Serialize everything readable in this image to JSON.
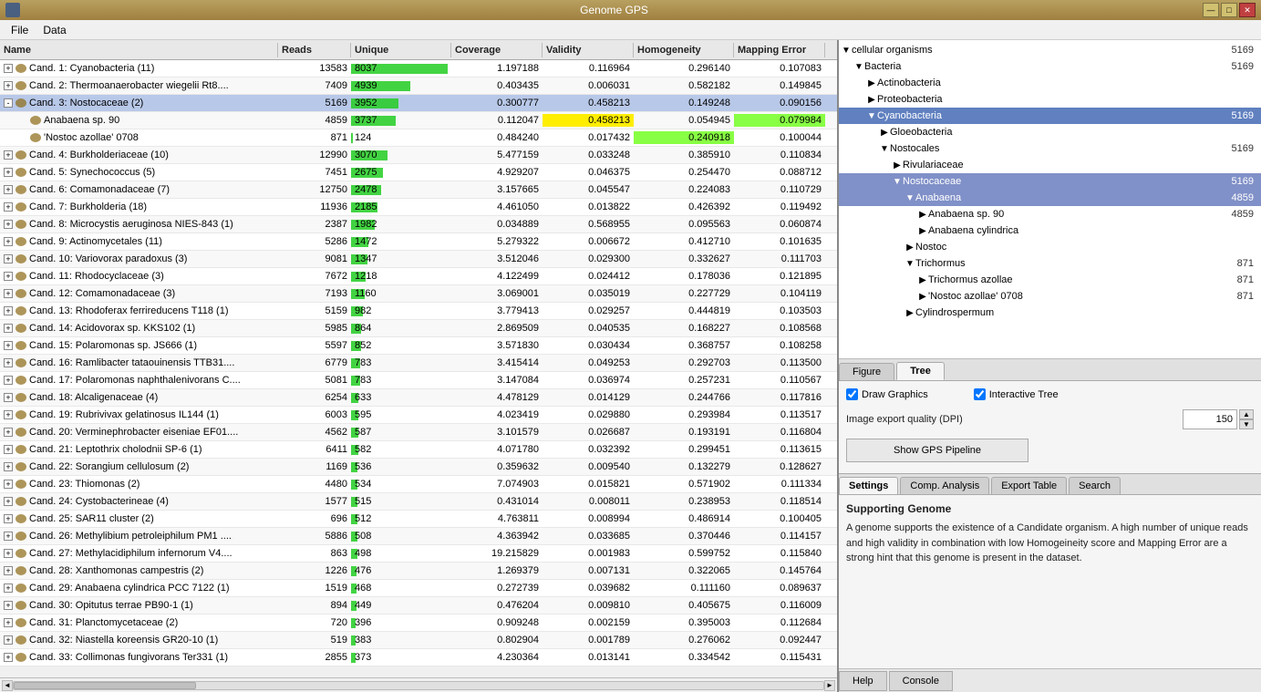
{
  "titlebar": {
    "title": "Genome GPS",
    "app_icon": "genome-icon",
    "controls": {
      "minimize": "—",
      "maximize": "□",
      "close": "✕"
    }
  },
  "menubar": {
    "items": [
      "File",
      "Data"
    ]
  },
  "table": {
    "columns": [
      "Name",
      "Reads",
      "Unique",
      "Coverage",
      "Validity",
      "Homogeneity",
      "Mapping Error"
    ],
    "rows": [
      {
        "name": "Cand. 1: Cyanobacteria (11)",
        "reads": "13583",
        "unique": "8037",
        "coverage": "1.197188",
        "validity": "0.116964",
        "homogeneity": "0.296140",
        "mapping": "0.107083",
        "indent": 0,
        "uniquePct": 100,
        "expanded": false
      },
      {
        "name": "Cand. 2: Thermoanaerobacter wiegelii Rt8....",
        "reads": "7409",
        "unique": "4939",
        "coverage": "0.403435",
        "validity": "0.006031",
        "homogeneity": "0.582182",
        "mapping": "0.149845",
        "indent": 0,
        "uniquePct": 60,
        "expanded": false
      },
      {
        "name": "Cand. 3: Nostocaceae (2)",
        "reads": "5169",
        "unique": "3952",
        "coverage": "0.300777",
        "validity": "0.458213",
        "homogeneity": "0.149248",
        "mapping": "0.090156",
        "indent": 0,
        "uniquePct": 48,
        "expanded": true,
        "selected": true
      },
      {
        "name": "Anabaena sp. 90",
        "reads": "4859",
        "unique": "3737",
        "coverage": "0.112047",
        "validity": "0.458213",
        "homogeneity": "0.054945",
        "mapping": "0.079984",
        "indent": 1,
        "uniquePct": 45,
        "expanded": false,
        "validityHL": true,
        "mappingHL": true
      },
      {
        "name": "'Nostoc azollae' 0708",
        "reads": "871",
        "unique": "124",
        "coverage": "0.484240",
        "validity": "0.017432",
        "homogeneity": "0.240918",
        "mapping": "0.100044",
        "indent": 1,
        "uniquePct": 1,
        "expanded": false,
        "homogeneityHL": true
      },
      {
        "name": "Cand. 4: Burkholderiaceae (10)",
        "reads": "12990",
        "unique": "3070",
        "coverage": "5.477159",
        "validity": "0.033248",
        "homogeneity": "0.385910",
        "mapping": "0.110834",
        "indent": 0,
        "uniquePct": 36,
        "expanded": false
      },
      {
        "name": "Cand. 5: Synechococcus (5)",
        "reads": "7451",
        "unique": "2675",
        "coverage": "4.929207",
        "validity": "0.046375",
        "homogeneity": "0.254470",
        "mapping": "0.088712",
        "indent": 0,
        "uniquePct": 32,
        "expanded": false
      },
      {
        "name": "Cand. 6: Comamonadaceae (7)",
        "reads": "12750",
        "unique": "2478",
        "coverage": "3.157665",
        "validity": "0.045547",
        "homogeneity": "0.224083",
        "mapping": "0.110729",
        "indent": 0,
        "uniquePct": 29,
        "expanded": false
      },
      {
        "name": "Cand. 7: Burkholderia (18)",
        "reads": "11936",
        "unique": "2185",
        "coverage": "4.461050",
        "validity": "0.013822",
        "homogeneity": "0.426392",
        "mapping": "0.119492",
        "indent": 0,
        "uniquePct": 26,
        "expanded": false
      },
      {
        "name": "Cand. 8: Microcystis aeruginosa NIES-843 (1)",
        "reads": "2387",
        "unique": "1982",
        "coverage": "0.034889",
        "validity": "0.568955",
        "homogeneity": "0.095563",
        "mapping": "0.060874",
        "indent": 0,
        "uniquePct": 24,
        "expanded": false
      },
      {
        "name": "Cand. 9: Actinomycetales (11)",
        "reads": "5286",
        "unique": "1472",
        "coverage": "5.279322",
        "validity": "0.006672",
        "homogeneity": "0.412710",
        "mapping": "0.101635",
        "indent": 0,
        "uniquePct": 18,
        "expanded": false
      },
      {
        "name": "Cand. 10: Variovorax paradoxus (3)",
        "reads": "9081",
        "unique": "1347",
        "coverage": "3.512046",
        "validity": "0.029300",
        "homogeneity": "0.332627",
        "mapping": "0.111703",
        "indent": 0,
        "uniquePct": 16,
        "expanded": false
      },
      {
        "name": "Cand. 11: Rhodocyclaceae (3)",
        "reads": "7672",
        "unique": "1218",
        "coverage": "4.122499",
        "validity": "0.024412",
        "homogeneity": "0.178036",
        "mapping": "0.121895",
        "indent": 0,
        "uniquePct": 15,
        "expanded": false
      },
      {
        "name": "Cand. 12: Comamonadaceae (3)",
        "reads": "7193",
        "unique": "1160",
        "coverage": "3.069001",
        "validity": "0.035019",
        "homogeneity": "0.227729",
        "mapping": "0.104119",
        "indent": 0,
        "uniquePct": 14,
        "expanded": false
      },
      {
        "name": "Cand. 13: Rhodoferax ferrireducens T118 (1)",
        "reads": "5159",
        "unique": "982",
        "coverage": "3.779413",
        "validity": "0.029257",
        "homogeneity": "0.444819",
        "mapping": "0.103503",
        "indent": 0,
        "uniquePct": 12,
        "expanded": false
      },
      {
        "name": "Cand. 14: Acidovorax sp. KKS102 (1)",
        "reads": "5985",
        "unique": "864",
        "coverage": "2.869509",
        "validity": "0.040535",
        "homogeneity": "0.168227",
        "mapping": "0.108568",
        "indent": 0,
        "uniquePct": 10,
        "expanded": false
      },
      {
        "name": "Cand. 15: Polaromonas sp. JS666 (1)",
        "reads": "5597",
        "unique": "852",
        "coverage": "3.571830",
        "validity": "0.030434",
        "homogeneity": "0.368757",
        "mapping": "0.108258",
        "indent": 0,
        "uniquePct": 10,
        "expanded": false
      },
      {
        "name": "Cand. 16: Ramlibacter tataouinensis TTB31....",
        "reads": "6779",
        "unique": "783",
        "coverage": "3.415414",
        "validity": "0.049253",
        "homogeneity": "0.292703",
        "mapping": "0.113500",
        "indent": 0,
        "uniquePct": 9,
        "expanded": false
      },
      {
        "name": "Cand. 17: Polaromonas naphthalenivorans C....",
        "reads": "5081",
        "unique": "783",
        "coverage": "3.147084",
        "validity": "0.036974",
        "homogeneity": "0.257231",
        "mapping": "0.110567",
        "indent": 0,
        "uniquePct": 9,
        "expanded": false
      },
      {
        "name": "Cand. 18: Alcaligenaceae (4)",
        "reads": "6254",
        "unique": "633",
        "coverage": "4.478129",
        "validity": "0.014129",
        "homogeneity": "0.244766",
        "mapping": "0.117816",
        "indent": 0,
        "uniquePct": 8,
        "expanded": false
      },
      {
        "name": "Cand. 19: Rubrivivax gelatinosus IL144 (1)",
        "reads": "6003",
        "unique": "595",
        "coverage": "4.023419",
        "validity": "0.029880",
        "homogeneity": "0.293984",
        "mapping": "0.113517",
        "indent": 0,
        "uniquePct": 7,
        "expanded": false
      },
      {
        "name": "Cand. 20: Verminephrobacter eiseniae EF01....",
        "reads": "4562",
        "unique": "587",
        "coverage": "3.101579",
        "validity": "0.026687",
        "homogeneity": "0.193191",
        "mapping": "0.116804",
        "indent": 0,
        "uniquePct": 7,
        "expanded": false
      },
      {
        "name": "Cand. 21: Leptothrix cholodnii SP-6 (1)",
        "reads": "6411",
        "unique": "582",
        "coverage": "4.071780",
        "validity": "0.032392",
        "homogeneity": "0.299451",
        "mapping": "0.113615",
        "indent": 0,
        "uniquePct": 7,
        "expanded": false
      },
      {
        "name": "Cand. 22: Sorangium cellulosum (2)",
        "reads": "1169",
        "unique": "536",
        "coverage": "0.359632",
        "validity": "0.009540",
        "homogeneity": "0.132279",
        "mapping": "0.128627",
        "indent": 0,
        "uniquePct": 7,
        "expanded": false
      },
      {
        "name": "Cand. 23: Thiomonas (2)",
        "reads": "4480",
        "unique": "534",
        "coverage": "7.074903",
        "validity": "0.015821",
        "homogeneity": "0.571902",
        "mapping": "0.111334",
        "indent": 0,
        "uniquePct": 7,
        "expanded": false
      },
      {
        "name": "Cand. 24: Cystobacterineae (4)",
        "reads": "1577",
        "unique": "515",
        "coverage": "0.431014",
        "validity": "0.008011",
        "homogeneity": "0.238953",
        "mapping": "0.118514",
        "indent": 0,
        "uniquePct": 6,
        "expanded": false
      },
      {
        "name": "Cand. 25: SAR11 cluster (2)",
        "reads": "696",
        "unique": "512",
        "coverage": "4.763811",
        "validity": "0.008994",
        "homogeneity": "0.486914",
        "mapping": "0.100405",
        "indent": 0,
        "uniquePct": 6,
        "expanded": false
      },
      {
        "name": "Cand. 26: Methylibium petroleiphilum PM1 ....",
        "reads": "5886",
        "unique": "508",
        "coverage": "4.363942",
        "validity": "0.033685",
        "homogeneity": "0.370446",
        "mapping": "0.114157",
        "indent": 0,
        "uniquePct": 6,
        "expanded": false
      },
      {
        "name": "Cand. 27: Methylacidiphilum infernorum V4....",
        "reads": "863",
        "unique": "498",
        "coverage": "19.215829",
        "validity": "0.001983",
        "homogeneity": "0.599752",
        "mapping": "0.115840",
        "indent": 0,
        "uniquePct": 6,
        "expanded": false
      },
      {
        "name": "Cand. 28: Xanthomonas campestris (2)",
        "reads": "1226",
        "unique": "476",
        "coverage": "1.269379",
        "validity": "0.007131",
        "homogeneity": "0.322065",
        "mapping": "0.145764",
        "indent": 0,
        "uniquePct": 6,
        "expanded": false
      },
      {
        "name": "Cand. 29: Anabaena cylindrica PCC 7122 (1)",
        "reads": "1519",
        "unique": "468",
        "coverage": "0.272739",
        "validity": "0.039682",
        "homogeneity": "0.111160",
        "mapping": "0.089637",
        "indent": 0,
        "uniquePct": 6,
        "expanded": false
      },
      {
        "name": "Cand. 30: Opitutus terrae PB90-1 (1)",
        "reads": "894",
        "unique": "449",
        "coverage": "0.476204",
        "validity": "0.009810",
        "homogeneity": "0.405675",
        "mapping": "0.116009",
        "indent": 0,
        "uniquePct": 5,
        "expanded": false
      },
      {
        "name": "Cand. 31: Planctomycetaceae (2)",
        "reads": "720",
        "unique": "396",
        "coverage": "0.909248",
        "validity": "0.002159",
        "homogeneity": "0.395003",
        "mapping": "0.112684",
        "indent": 0,
        "uniquePct": 5,
        "expanded": false
      },
      {
        "name": "Cand. 32: Niastella koreensis GR20-10 (1)",
        "reads": "519",
        "unique": "383",
        "coverage": "0.802904",
        "validity": "0.001789",
        "homogeneity": "0.276062",
        "mapping": "0.092447",
        "indent": 0,
        "uniquePct": 5,
        "expanded": false
      },
      {
        "name": "Cand. 33: Collimonas fungivorans Ter331 (1)",
        "reads": "2855",
        "unique": "373",
        "coverage": "4.230364",
        "validity": "0.013141",
        "homogeneity": "0.334542",
        "mapping": "0.115431",
        "indent": 0,
        "uniquePct": 5,
        "expanded": false
      }
    ]
  },
  "tree": {
    "nodes": [
      {
        "label": "cellular organisms",
        "count": "5169",
        "indent": 0,
        "expanded": true,
        "selected": false
      },
      {
        "label": "Bacteria",
        "count": "5169",
        "indent": 1,
        "expanded": true,
        "selected": false
      },
      {
        "label": "Actinobacteria",
        "count": "",
        "indent": 2,
        "expanded": false,
        "selected": false
      },
      {
        "label": "Proteobacteria",
        "count": "",
        "indent": 2,
        "expanded": false,
        "selected": false
      },
      {
        "label": "Cyanobacteria",
        "count": "5169",
        "indent": 2,
        "expanded": true,
        "selected": true
      },
      {
        "label": "Gloeobacteria",
        "count": "",
        "indent": 3,
        "expanded": false,
        "selected": false
      },
      {
        "label": "Nostocales",
        "count": "5169",
        "indent": 3,
        "expanded": true,
        "selected": false
      },
      {
        "label": "Rivulariaceae",
        "count": "",
        "indent": 4,
        "expanded": false,
        "selected": false
      },
      {
        "label": "Nostocaceae",
        "count": "5169",
        "indent": 4,
        "expanded": true,
        "selected": true
      },
      {
        "label": "Anabaena",
        "count": "4859",
        "indent": 5,
        "expanded": true,
        "selected": true
      },
      {
        "label": "Anabaena sp. 90",
        "count": "4859",
        "indent": 6,
        "expanded": false,
        "selected": false
      },
      {
        "label": "Anabaena cylindrica",
        "count": "",
        "indent": 6,
        "expanded": false,
        "selected": false
      },
      {
        "label": "Nostoc",
        "count": "",
        "indent": 5,
        "expanded": false,
        "selected": false
      },
      {
        "label": "Trichormus",
        "count": "871",
        "indent": 5,
        "expanded": true,
        "selected": false
      },
      {
        "label": "Trichormus azollae",
        "count": "871",
        "indent": 6,
        "expanded": false,
        "selected": false
      },
      {
        "label": "'Nostoc azollae' 0708",
        "count": "871",
        "indent": 6,
        "expanded": false,
        "selected": false
      },
      {
        "label": "Cylindrospermum",
        "count": "",
        "indent": 5,
        "expanded": false,
        "selected": false
      }
    ]
  },
  "tabs": {
    "figure_label": "Figure",
    "tree_label": "Tree",
    "active": "Tree"
  },
  "settings": {
    "draw_graphics": true,
    "draw_graphics_label": "Draw Graphics",
    "interactive_tree": true,
    "interactive_tree_label": "Interactive Tree",
    "image_export_label": "Image export quality (DPI)",
    "dpi_value": "150",
    "show_pipeline_btn": "Show GPS Pipeline"
  },
  "bottom_tabs": {
    "settings_label": "Settings",
    "comp_analysis_label": "Comp. Analysis",
    "export_table_label": "Export Table",
    "search_label": "Search",
    "active": "Settings"
  },
  "supporting": {
    "title": "Supporting Genome",
    "text": "A genome supports the existence of a Candidate organism. A high number of unique reads and high validity in combination with low Homogeineity score and Mapping Error are a strong hint that this genome is present in the dataset."
  },
  "footer": {
    "help_label": "Help",
    "console_label": "Console"
  }
}
